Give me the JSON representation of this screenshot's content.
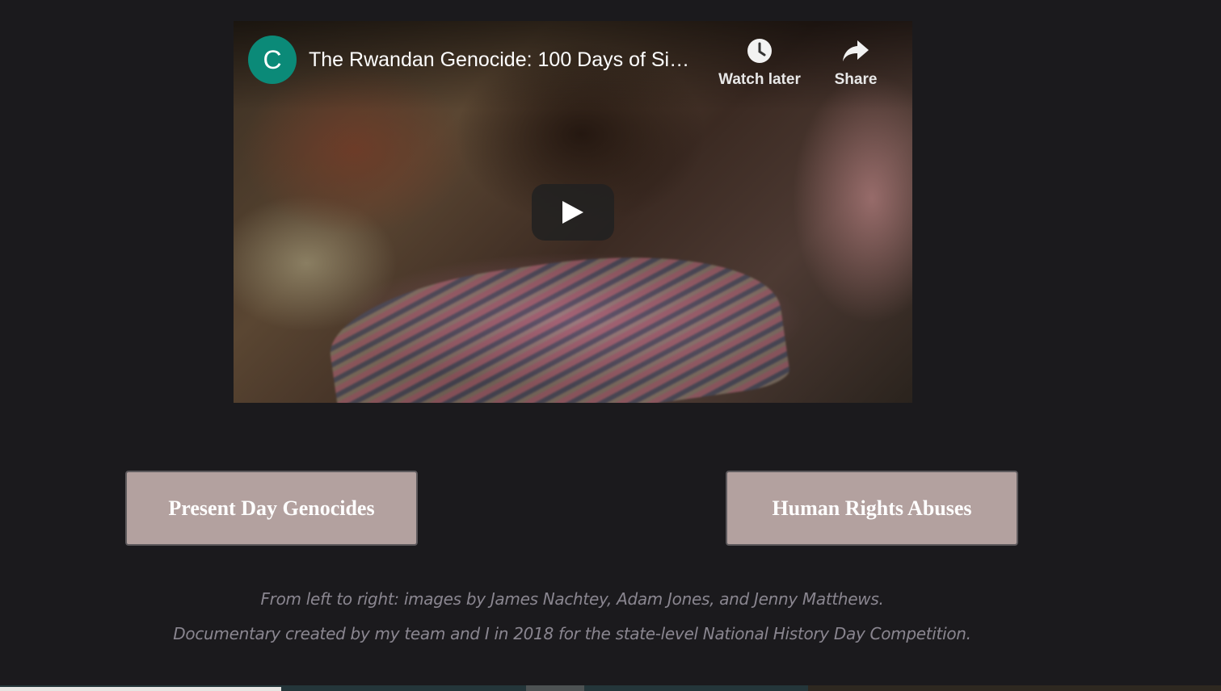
{
  "video": {
    "channel_initial": "C",
    "title": "The Rwandan Genocide: 100 Days of Si…",
    "watch_later_label": "Watch later",
    "share_label": "Share",
    "icons": {
      "watch_later": "clock-icon",
      "share": "share-arrow-icon",
      "play": "play-icon"
    }
  },
  "buttons": {
    "left_label": "Present Day Genocides",
    "right_label": "Human Rights Abuses"
  },
  "captions": {
    "credits": "From left to right: images by James Nachtey, Adam Jones, and Jenny Matthews.",
    "documentary": "Documentary created by my team and I in 2018 for the state-level National History Day Competition."
  },
  "colors": {
    "page_background": "#1b1a1d",
    "button_background": "#b3a19f",
    "avatar": "#0b8a78",
    "caption_text": "#8a8690"
  }
}
